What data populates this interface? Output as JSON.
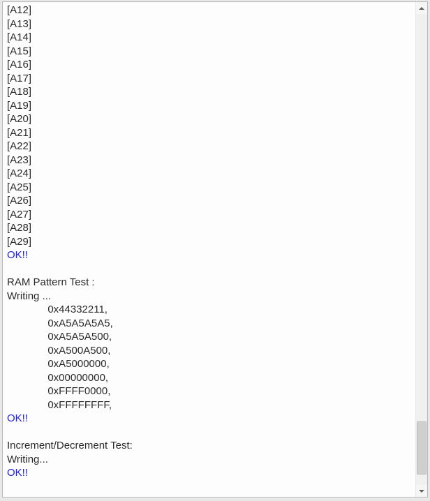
{
  "log": {
    "address_lines": [
      "[A12]",
      "[A13]",
      "[A14]",
      "[A15]",
      "[A16]",
      "[A17]",
      "[A18]",
      "[A19]",
      "[A20]",
      "[A21]",
      "[A22]",
      "[A23]",
      "[A24]",
      "[A25]",
      "[A26]",
      "[A27]",
      "[A28]",
      "[A29]"
    ],
    "ok_addresses": "OK!!",
    "blank1": "",
    "ram_header": "RAM Pattern Test :",
    "ram_writing": "Writing ...",
    "ram_patterns": [
      "              0x44332211,",
      "              0xA5A5A5A5,",
      "              0xA5A5A500,",
      "              0xA500A500,",
      "              0xA5000000,",
      "              0x00000000,",
      "              0xFFFF0000,",
      "              0xFFFFFFFF,"
    ],
    "ok_ram": "OK!!",
    "blank2": "",
    "incdec_header": "Increment/Decrement Test:",
    "incdec_writing": "Writing...",
    "ok_incdec": "OK!!"
  }
}
